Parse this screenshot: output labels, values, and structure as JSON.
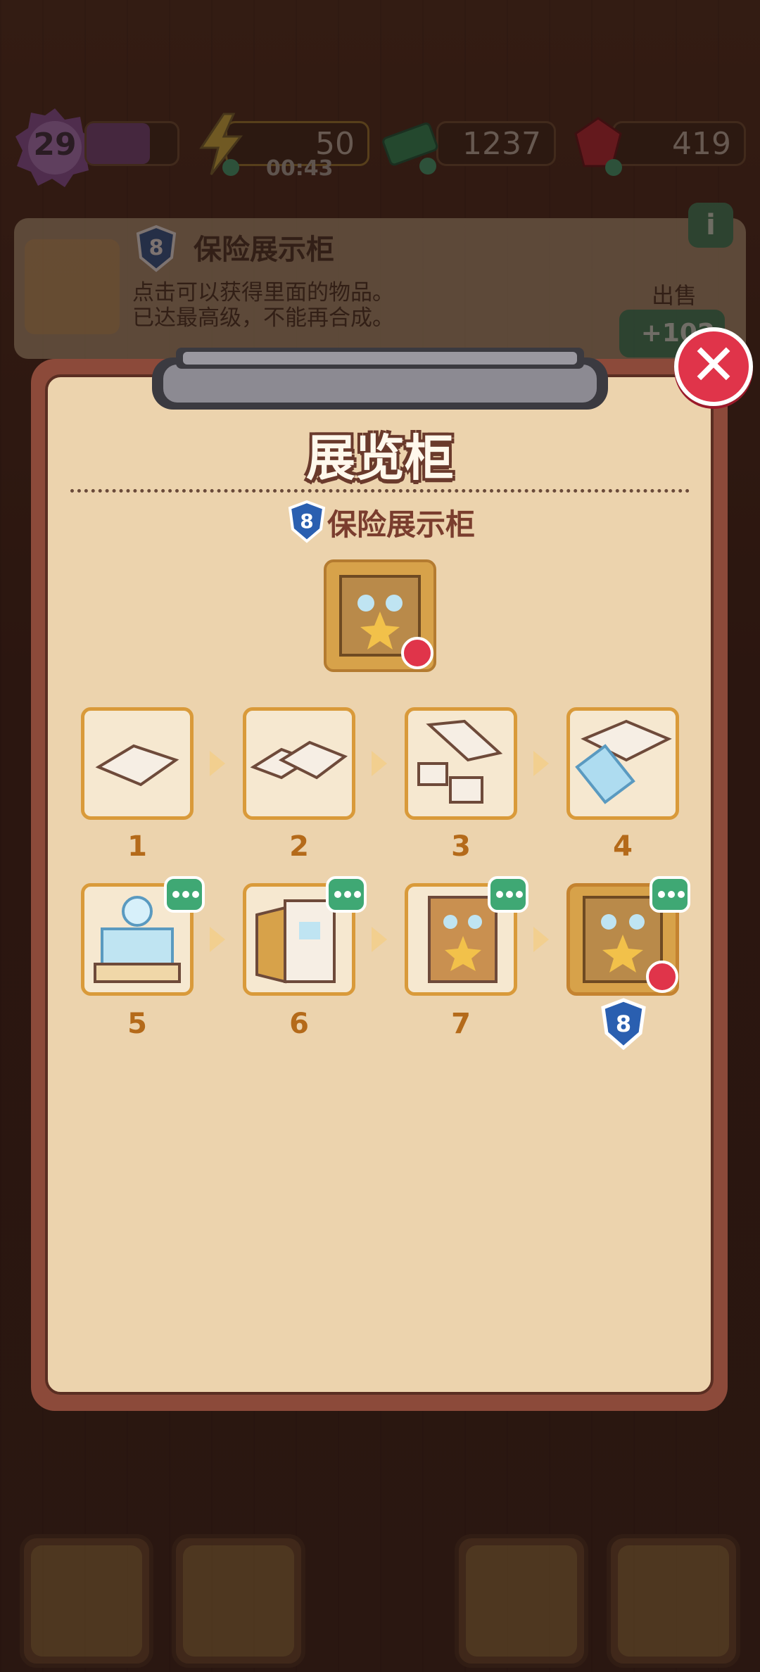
{
  "hud": {
    "level": "29",
    "xp_fill": 0.7,
    "energy": "50",
    "energy_timer": "00:43",
    "cash": "1237",
    "gems": "419"
  },
  "info_panel": {
    "item_level": "8",
    "item_name": "保险展示柜",
    "line1": "点击可以获得里面的物品。",
    "line2": "已达最高级，不能再合成。",
    "sell_label": "出售",
    "sell_value": "+102",
    "info_button": "i"
  },
  "modal": {
    "title": "展览柜",
    "subtitle_level": "8",
    "subtitle": "保险展示柜",
    "close_label": "✕",
    "chain": [
      {
        "num": "1"
      },
      {
        "num": "2"
      },
      {
        "num": "3"
      },
      {
        "num": "4"
      },
      {
        "num": "5"
      },
      {
        "num": "6"
      },
      {
        "num": "7"
      },
      {
        "num": "8"
      }
    ],
    "current_level_badge": "8"
  },
  "colors": {
    "modal_bg": "#ecd3ad",
    "modal_frame": "#8c4a3a",
    "tile_border": "#d99a3a",
    "number": "#b46a1a",
    "close_red": "#e0344a",
    "more_green": "#3fa874"
  },
  "icons": {
    "level_badge": "purple-gear-icon",
    "energy": "lightning-icon",
    "cash": "cash-stack-icon",
    "gems": "ruby-icon",
    "close": "close-icon",
    "bottom_nav": [
      "back-arrow-icon",
      "backpack-icon",
      "basket-icon",
      "clipboard-star-icon"
    ]
  }
}
